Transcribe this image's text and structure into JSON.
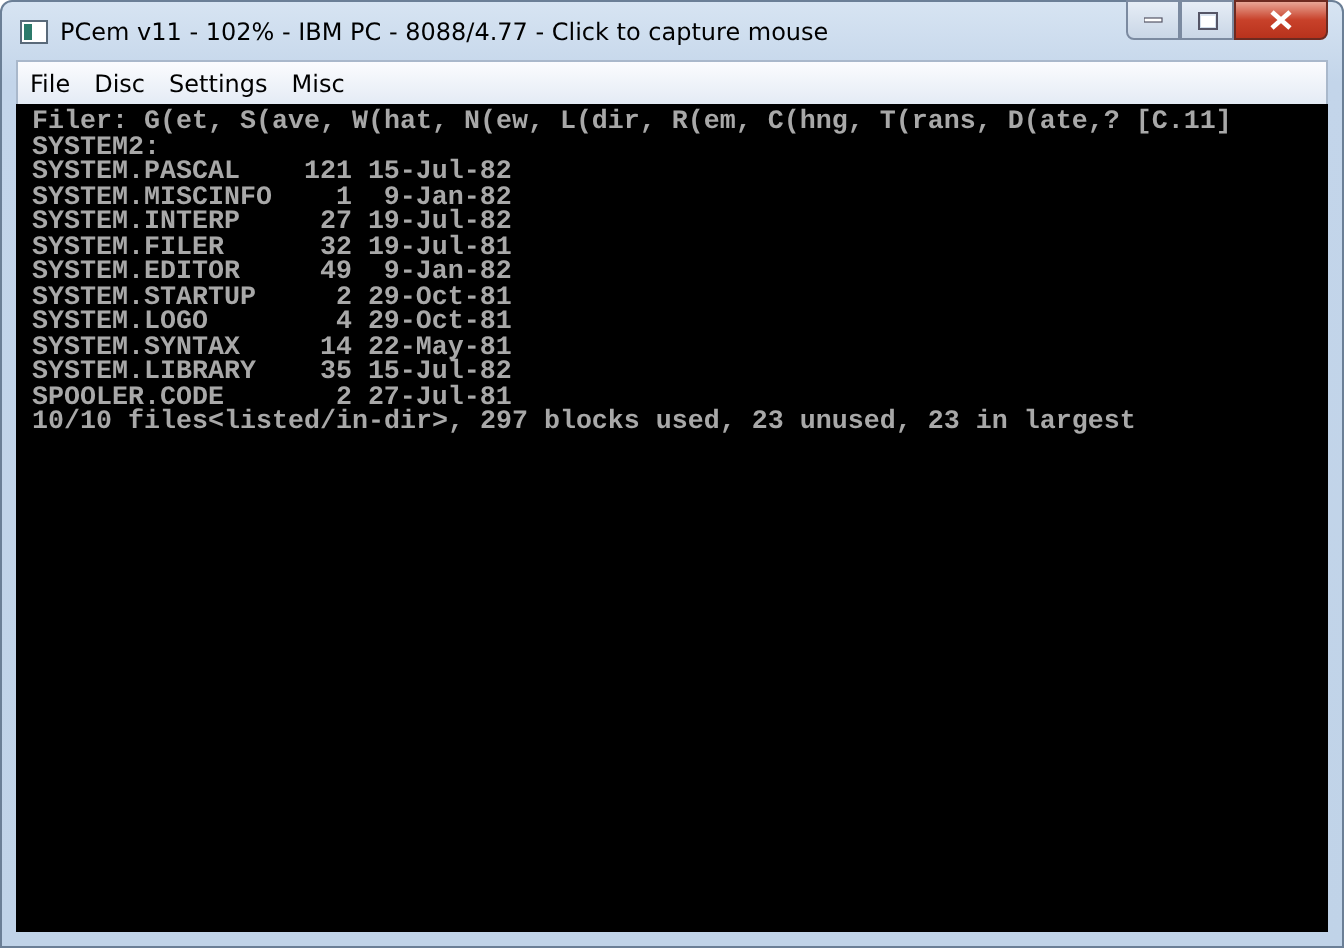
{
  "window": {
    "title": "PCem v11 - 102% - IBM PC - 8088/4.77 - Click to capture mouse"
  },
  "menu": [
    "File",
    "Disc",
    "Settings",
    "Misc"
  ],
  "screen": {
    "prompt": "Filer: G(et, S(ave, W(hat, N(ew, L(dir, R(em, C(hng, T(rans, D(ate,? [C.11]",
    "volume": "SYSTEM2:",
    "files": [
      {
        "name": "SYSTEM.PASCAL",
        "blocks": "121",
        "date": "15-Jul-82"
      },
      {
        "name": "SYSTEM.MISCINFO",
        "blocks": "1",
        "date": "9-Jan-82"
      },
      {
        "name": "SYSTEM.INTERP",
        "blocks": "27",
        "date": "19-Jul-82"
      },
      {
        "name": "SYSTEM.FILER",
        "blocks": "32",
        "date": "19-Jul-81"
      },
      {
        "name": "SYSTEM.EDITOR",
        "blocks": "49",
        "date": "9-Jan-82"
      },
      {
        "name": "SYSTEM.STARTUP",
        "blocks": "2",
        "date": "29-Oct-81"
      },
      {
        "name": "SYSTEM.LOGO",
        "blocks": "4",
        "date": "29-Oct-81"
      },
      {
        "name": "SYSTEM.SYNTAX",
        "blocks": "14",
        "date": "22-May-81"
      },
      {
        "name": "SYSTEM.LIBRARY",
        "blocks": "35",
        "date": "15-Jul-82"
      },
      {
        "name": "SPOOLER.CODE",
        "blocks": "2",
        "date": "27-Jul-81"
      }
    ],
    "summary": "10/10 files<listed/in-dir>, 297 blocks used, 23 unused, 23 in largest"
  }
}
